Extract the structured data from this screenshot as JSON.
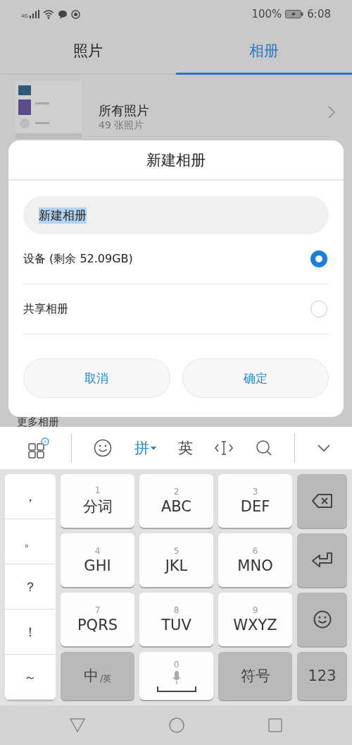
{
  "status_bar": {
    "network": "4G",
    "battery": "100%",
    "time": "6:08"
  },
  "tabs": [
    {
      "label": "照片",
      "selected": false
    },
    {
      "label": "相册",
      "selected": true
    }
  ],
  "albums": [
    {
      "name": "所有照片",
      "count": "49 张照片"
    }
  ],
  "section_title": "更多相册",
  "dialog": {
    "title": "新建相册",
    "field": {
      "value": "新建相册",
      "text_selected": true
    },
    "options": [
      {
        "label": "设备 (剩余 52.09GB)",
        "selected": true
      },
      {
        "label": "共享相册",
        "selected": false
      }
    ],
    "buttons": [
      "取消",
      "确定"
    ]
  },
  "keyboard": {
    "input_modes": [
      {
        "label": "拼",
        "selected": true
      },
      {
        "label": "英",
        "selected": false
      }
    ],
    "punctuation": [
      "，",
      "。",
      "？",
      "！",
      "～"
    ],
    "keys": [
      {
        "kind": "letter",
        "number": "1",
        "label": "分词"
      },
      {
        "kind": "letter",
        "number": "2",
        "label": "ABC"
      },
      {
        "kind": "letter",
        "number": "3",
        "label": "DEF"
      },
      {
        "kind": "backspace"
      },
      {
        "kind": "letter",
        "number": "4",
        "label": "GHI"
      },
      {
        "kind": "letter",
        "number": "5",
        "label": "JKL"
      },
      {
        "kind": "letter",
        "number": "6",
        "label": "MNO"
      },
      {
        "kind": "enter"
      },
      {
        "kind": "letter",
        "number": "7",
        "label": "PQRS"
      },
      {
        "kind": "letter",
        "number": "8",
        "label": "TUV"
      },
      {
        "kind": "letter",
        "number": "9",
        "label": "WXYZ"
      },
      {
        "kind": "emoji"
      },
      {
        "kind": "language",
        "label": "中",
        "sub": "/英"
      },
      {
        "kind": "space",
        "number": "0"
      },
      {
        "kind": "function",
        "label": "符号"
      },
      {
        "kind": "function",
        "label": "123"
      }
    ]
  }
}
